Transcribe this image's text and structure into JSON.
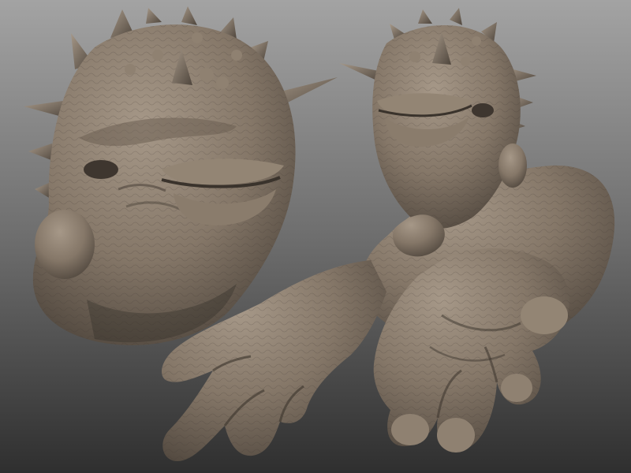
{
  "scene": {
    "subject_left": "head-sculpt",
    "subject_right": "head-and-hand-sculpt",
    "palette": {
      "bg_top": "#a3a3a3",
      "bg_mid": "#6e6e6e",
      "bg_bottom": "#2f2f2f",
      "clay_light": "#a69888",
      "clay_mid": "#857768",
      "clay_dark": "#4e453c",
      "clay_shadow": "#2f2a25"
    }
  }
}
